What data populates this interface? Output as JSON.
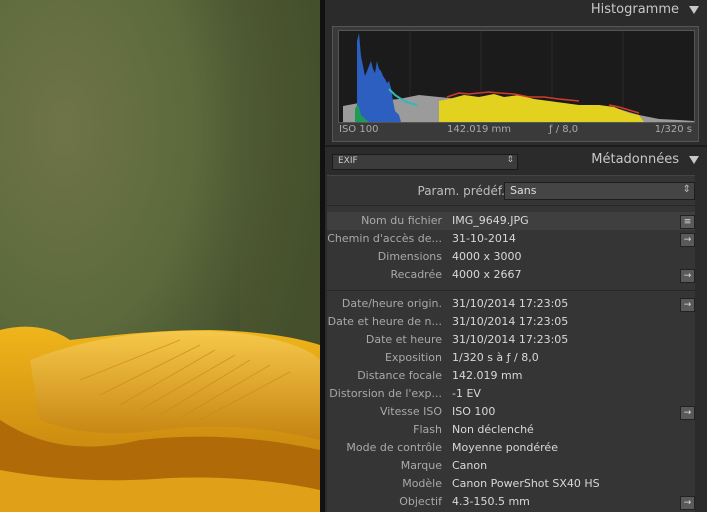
{
  "histogram": {
    "title": "Histogramme",
    "iso": "ISO 100",
    "focal": "142.019 mm",
    "aperture": "ƒ / 8,0",
    "shutter": "1/320 s"
  },
  "metadata": {
    "preset_view": "EXIF",
    "title": "Métadonnées",
    "param_label": "Param. prédéf.",
    "param_value": "Sans",
    "groups": [
      [
        {
          "label": "Nom du fichier",
          "value": "IMG_9649.JPG",
          "action": "list-icon",
          "selected": true
        },
        {
          "label": "Chemin d'accès de...",
          "value": "31-10-2014",
          "action": "arrow-right-icon"
        },
        {
          "label": "Dimensions",
          "value": "4000 x 3000"
        },
        {
          "label": "Recadrée",
          "value": "4000 x 2667",
          "action": "arrow-right-icon"
        }
      ],
      [
        {
          "label": "Date/heure origin.",
          "value": "31/10/2014 17:23:05",
          "action": "arrow-right-icon"
        },
        {
          "label": "Date et heure de n...",
          "value": "31/10/2014 17:23:05"
        },
        {
          "label": "Date et heure",
          "value": "31/10/2014 17:23:05"
        },
        {
          "label": "Exposition",
          "value": "1/320 s à ƒ / 8,0"
        },
        {
          "label": "Distance focale",
          "value": "142.019 mm"
        },
        {
          "label": "Distorsion de l'exp...",
          "value": "-1 EV"
        },
        {
          "label": "Vitesse ISO",
          "value": "ISO 100",
          "action": "arrow-right-icon"
        },
        {
          "label": "Flash",
          "value": "Non déclenché"
        },
        {
          "label": "Mode de contrôle",
          "value": "Moyenne pondérée"
        },
        {
          "label": "Marque",
          "value": "Canon"
        },
        {
          "label": "Modèle",
          "value": "Canon PowerShot SX40 HS"
        },
        {
          "label": "Objectif",
          "value": "4.3-150.5 mm",
          "action": "arrow-right-icon"
        }
      ]
    ]
  },
  "colors": {
    "panel_bg": "#2b2b2b",
    "histo_blue": "#2c5fc0",
    "histo_yellow": "#e2d21f",
    "histo_red": "#d23a2a",
    "histo_gray": "#9b9b9b"
  }
}
